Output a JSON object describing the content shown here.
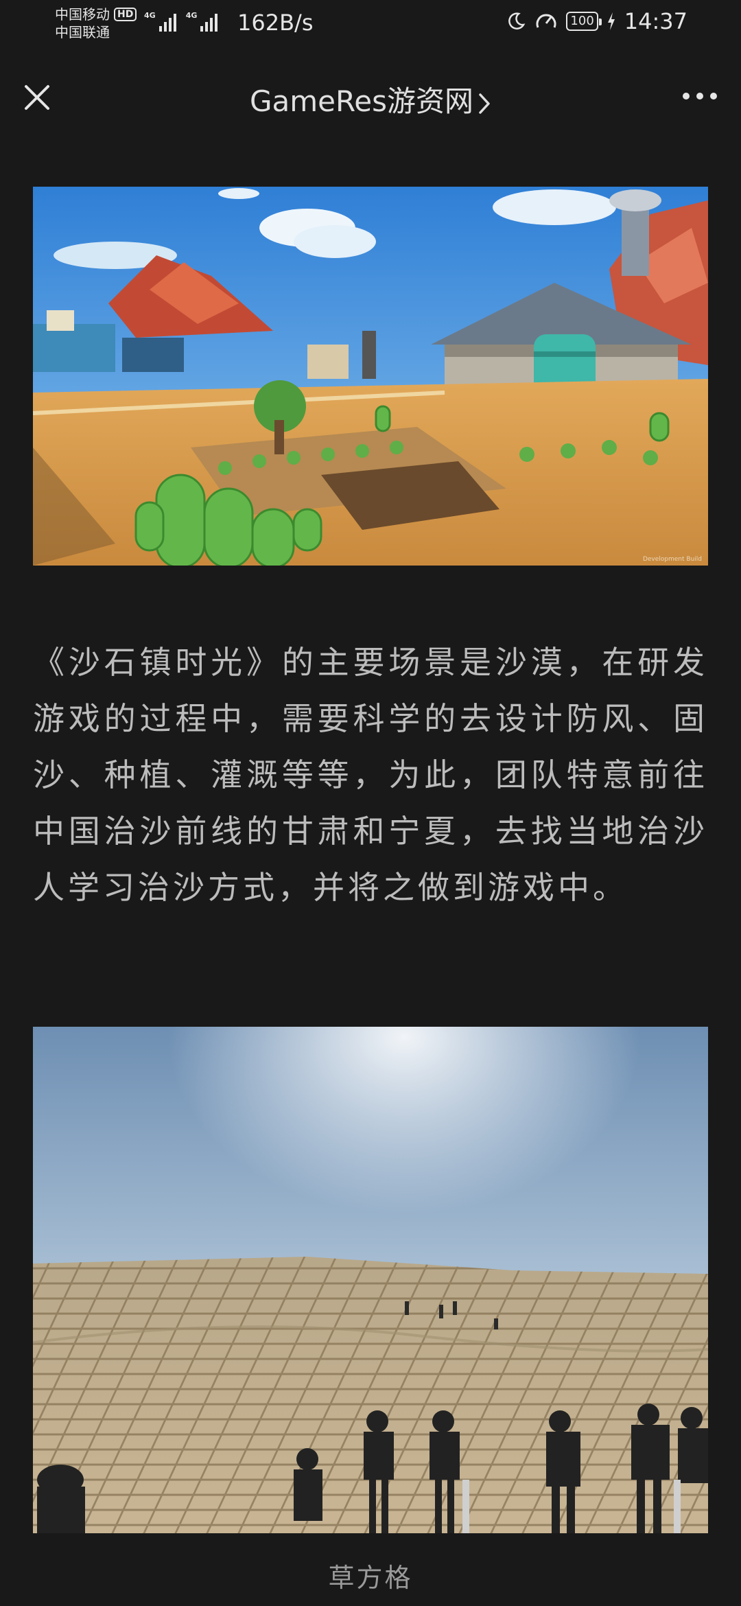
{
  "status_bar": {
    "carrier_1": "中国移动",
    "hd_badge": "HD",
    "carrier_2": "中国联通",
    "network_1": "4G",
    "network_2": "4G",
    "net_speed": "162B/s",
    "battery": "100",
    "time": "14:37"
  },
  "title_bar": {
    "title": "GameRes游资网"
  },
  "article": {
    "paragraph": "《沙石镇时光》的主要场景是沙漠，在研发游戏的过程中，需要科学的去设计防风、固沙、种植、灌溉等等，为此，团队特意前往中国治沙前线的甘肃和宁夏，去找当地治沙人学习治沙方式，并将之做到游戏中。",
    "image_1_watermark": "Development Build",
    "caption": "草方格"
  }
}
